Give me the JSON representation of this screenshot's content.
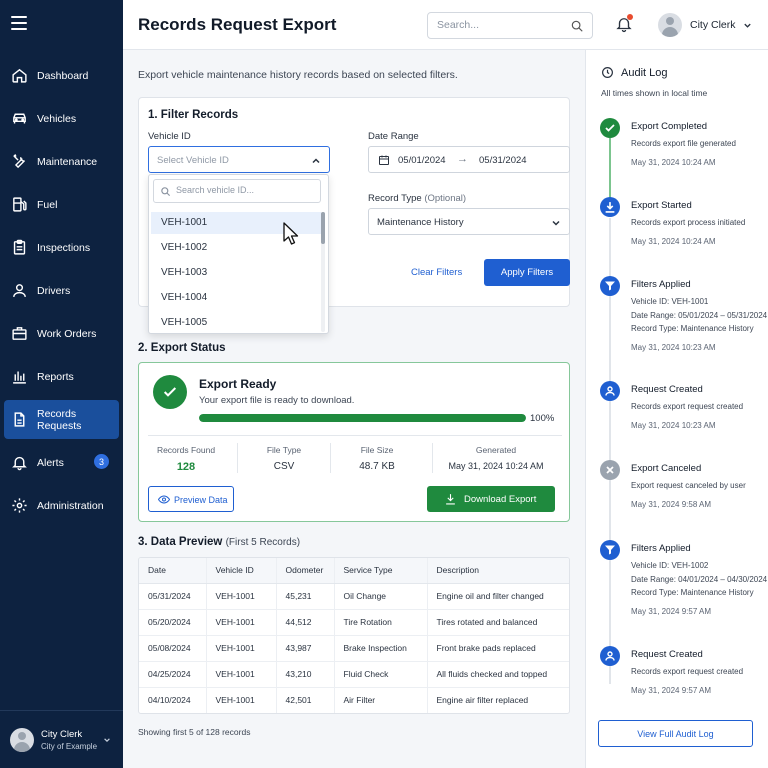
{
  "nav": {
    "items": [
      {
        "label": "Dashboard",
        "icon": "home-icon"
      },
      {
        "label": "Vehicles",
        "icon": "car-icon"
      },
      {
        "label": "Maintenance",
        "icon": "wrench-icon"
      },
      {
        "label": "Fuel",
        "icon": "fuel-icon"
      },
      {
        "label": "Inspections",
        "icon": "clipboard-icon"
      },
      {
        "label": "Drivers",
        "icon": "user-icon"
      },
      {
        "label": "Work Orders",
        "icon": "briefcase-icon"
      },
      {
        "label": "Reports",
        "icon": "bar-chart-icon"
      },
      {
        "label": "Records Requests",
        "icon": "folder-icon",
        "active": true
      },
      {
        "label": "Alerts",
        "icon": "bell-icon",
        "badge": "3"
      },
      {
        "label": "Administration",
        "icon": "gear-icon"
      }
    ],
    "user": {
      "name": "City Clerk",
      "org": "City of Example"
    }
  },
  "header": {
    "title": "Records Request Export",
    "search_placeholder": "Search...",
    "user_name": "City Clerk"
  },
  "intro": "Export vehicle maintenance history records based on selected filters.",
  "filters": {
    "title": "1. Filter Records",
    "vehicle_label": "Vehicle ID",
    "vehicle_placeholder": "Select Vehicle ID",
    "date_label": "Date Range",
    "date_start": "05/01/2024",
    "date_arrow": "→",
    "date_end": "05/31/2024",
    "record_type_label": "Record Type",
    "record_type_optional": "(Optional)",
    "record_type_value": "Maintenance History",
    "clear_label": "Clear Filters",
    "apply_label": "Apply Filters",
    "dropdown": {
      "search_placeholder": "Search vehicle ID...",
      "options": [
        "VEH-1001",
        "VEH-1002",
        "VEH-1003",
        "VEH-1004",
        "VEH-1005"
      ],
      "hovered": "VEH-1001"
    }
  },
  "status": {
    "title": "2. Export Status",
    "heading": "Export Ready",
    "subtext": "Your export file is ready to download.",
    "progress": 100,
    "progress_label": "100%",
    "metrics": [
      {
        "key": "Records Found",
        "value": "128"
      },
      {
        "key": "File Type",
        "value": "CSV"
      },
      {
        "key": "File Size",
        "value": "48.7 KB"
      },
      {
        "key": "Generated",
        "value": "May 31, 2024 10:24 AM"
      }
    ],
    "preview_label": "Preview Data",
    "download_label": "Download Export",
    "accent": "#1f8a3e"
  },
  "preview": {
    "title": "3. Data Preview",
    "title_sub": "(First 5 Records)",
    "columns": [
      "Date",
      "Vehicle ID",
      "Odometer",
      "Service Type",
      "Description"
    ],
    "rows": [
      [
        "05/31/2024",
        "VEH-1001",
        "45,231",
        "Oil Change",
        "Engine oil and filter changed"
      ],
      [
        "05/20/2024",
        "VEH-1001",
        "44,512",
        "Tire Rotation",
        "Tires rotated and balanced"
      ],
      [
        "05/08/2024",
        "VEH-1001",
        "43,987",
        "Brake Inspection",
        "Front brake pads replaced"
      ],
      [
        "04/25/2024",
        "VEH-1001",
        "43,210",
        "Fluid Check",
        "All fluids checked and topped"
      ],
      [
        "04/10/2024",
        "VEH-1001",
        "42,501",
        "Air Filter",
        "Engine air filter replaced"
      ]
    ],
    "footer": "Showing first 5 of 128 records"
  },
  "audit": {
    "title": "Audit Log",
    "subtitle": "All times shown in local time",
    "events": [
      {
        "title": "Export Completed",
        "lines": [
          "Records export file generated"
        ],
        "time": "May 31, 2024 10:24 AM",
        "icon": "check-icon",
        "color": "#1f8a3e"
      },
      {
        "title": "Export Started",
        "lines": [
          "Records export process initiated"
        ],
        "time": "May 31, 2024 10:24 AM",
        "icon": "download-icon",
        "color": "#1f5fd1"
      },
      {
        "title": "Filters Applied",
        "lines": [
          "Vehicle ID: VEH-1001",
          "Date Range: 05/01/2024 – 05/31/2024",
          "Record Type: Maintenance History"
        ],
        "time": "May 31, 2024 10:23 AM",
        "icon": "filter-icon",
        "color": "#1f5fd1"
      },
      {
        "title": "Request Created",
        "lines": [
          "Records export request created"
        ],
        "time": "May 31, 2024 10:23 AM",
        "icon": "user-icon",
        "color": "#1f5fd1"
      },
      {
        "title": "Export Canceled",
        "lines": [
          "Export request canceled by user"
        ],
        "time": "May 31, 2024 9:58 AM",
        "icon": "x-icon",
        "color": "#9aa3ae"
      },
      {
        "title": "Filters Applied",
        "lines": [
          "Vehicle ID: VEH-1002",
          "Date Range: 04/01/2024 – 04/30/2024",
          "Record Type: Maintenance History"
        ],
        "time": "May 31, 2024 9:57 AM",
        "icon": "filter-icon",
        "color": "#1f5fd1"
      },
      {
        "title": "Request Created",
        "lines": [
          "Records export request created"
        ],
        "time": "May 31, 2024 9:57 AM",
        "icon": "user-icon",
        "color": "#1f5fd1"
      }
    ],
    "view_all_label": "View Full Audit Log"
  }
}
